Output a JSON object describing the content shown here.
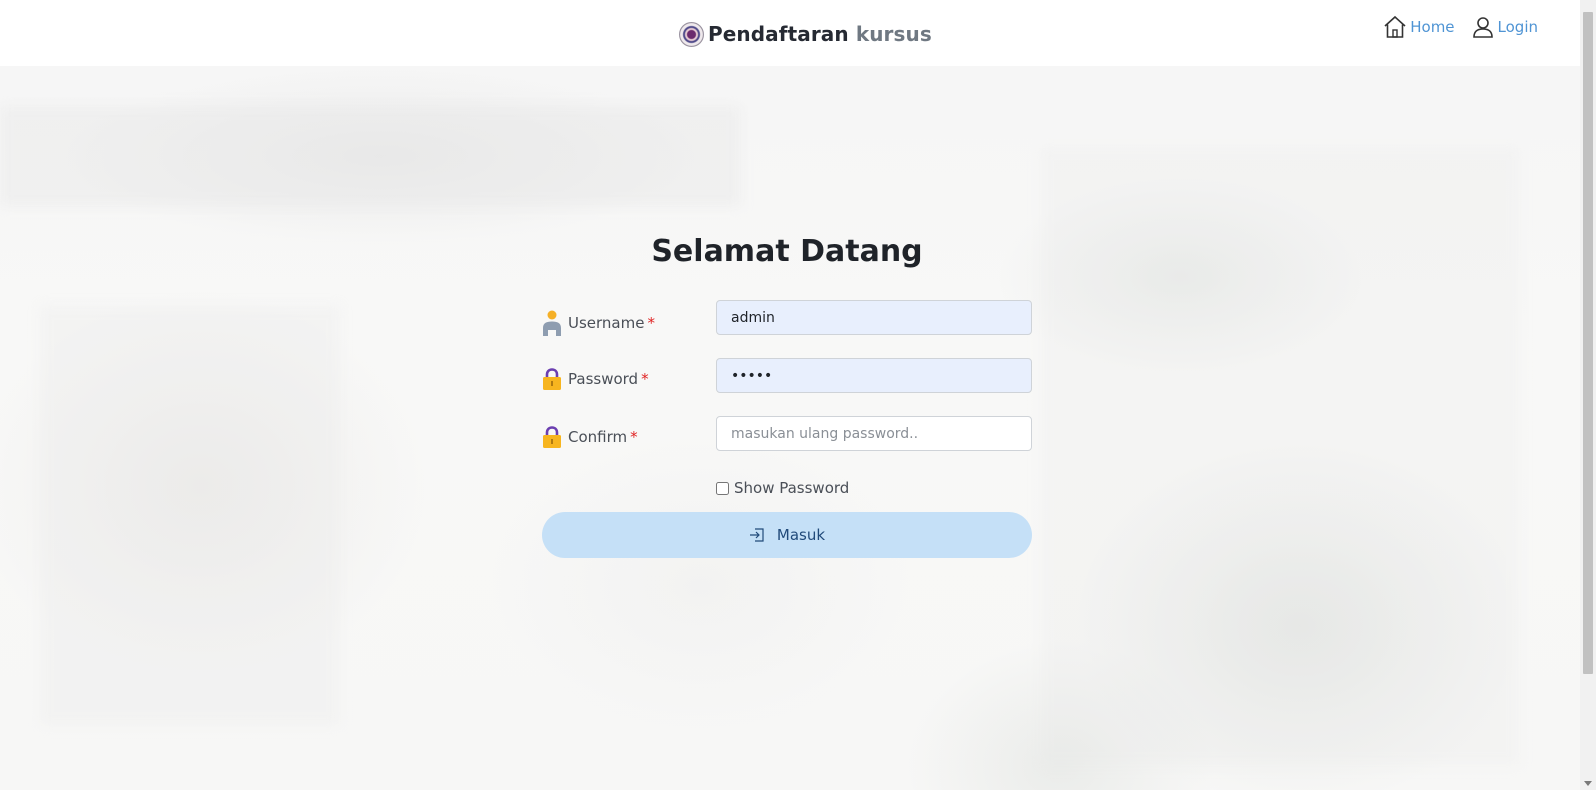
{
  "header": {
    "brand_main": "Pendaftaran",
    "brand_accent": "kursus",
    "logo_icon": "school-seal-icon",
    "nav": [
      {
        "label": "Home",
        "icon": "house-icon"
      },
      {
        "label": "Login",
        "icon": "user-outline-icon"
      }
    ]
  },
  "form": {
    "title": "Selamat Datang",
    "fields": [
      {
        "label": "Username",
        "required_mark": "*",
        "icon": "user-icon",
        "value": "admin",
        "placeholder": ""
      },
      {
        "label": "Password",
        "required_mark": "*",
        "icon": "lock-icon",
        "value": "•••••",
        "placeholder": ""
      },
      {
        "label": "Confirm",
        "required_mark": "*",
        "icon": "lock-icon",
        "value": "",
        "placeholder": "masukan ulang password.."
      }
    ],
    "show_password_label": "Show Password",
    "show_password_checked": false,
    "submit_label": "Masuk",
    "submit_icon": "sign-in-icon"
  },
  "colors": {
    "nav_link": "#4f94d4",
    "required": "#e02424",
    "submit_bg": "#c5e0f7",
    "filled_input_bg": "#e8effd"
  }
}
